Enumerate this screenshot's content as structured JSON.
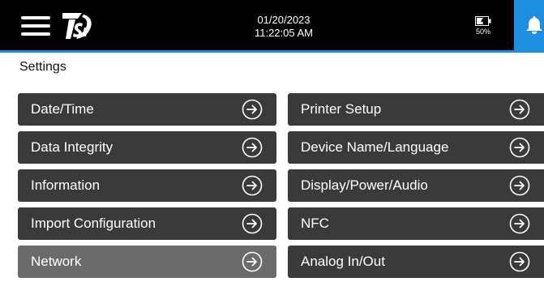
{
  "header": {
    "date": "01/20/2023",
    "time": "11:22:05 AM",
    "battery": "50%",
    "logo_text": "TSI",
    "colors": {
      "bar": "#000000",
      "accent": "#1c8fe0"
    },
    "icons": [
      "menu-icon",
      "tsi-logo",
      "battery-icon",
      "bell-icon"
    ]
  },
  "page": {
    "title": "Settings"
  },
  "menu": {
    "left": [
      {
        "label": "Date/Time"
      },
      {
        "label": "Data Integrity"
      },
      {
        "label": "Information"
      },
      {
        "label": "Import Configuration"
      },
      {
        "label": "Network",
        "selected": true
      }
    ],
    "right": [
      {
        "label": "Printer Setup"
      },
      {
        "label": "Device Name/Language"
      },
      {
        "label": "Display/Power/Audio"
      },
      {
        "label": "NFC"
      },
      {
        "label": "Analog In/Out"
      }
    ],
    "colors": {
      "tile": "#3a3a3a",
      "tile_selected": "#6b6b6b",
      "text": "#ffffff"
    },
    "arrow_icon": "arrow-right-circle-icon"
  }
}
